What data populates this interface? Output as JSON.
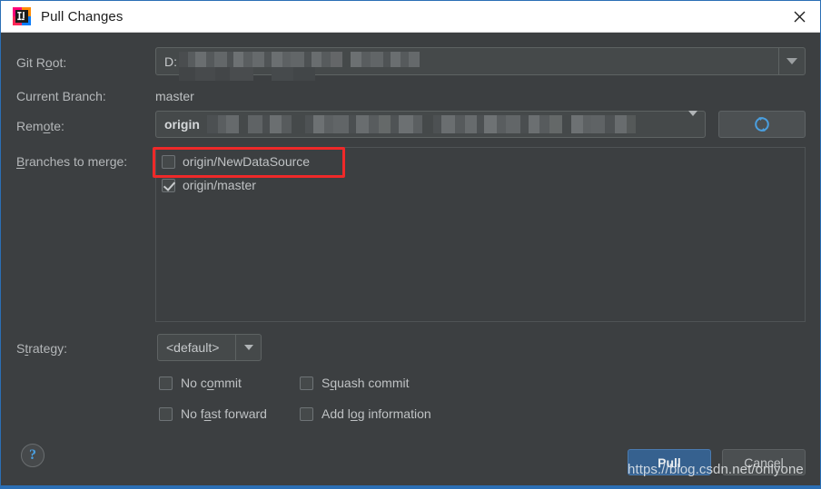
{
  "window": {
    "title": "Pull Changes",
    "app_icon": "intellij-idea-icon",
    "close_icon": "close-icon",
    "accent_color": "#2b6fb5",
    "background_color": "#3c3f41"
  },
  "form": {
    "git_root": {
      "label_pre": "Git R",
      "label_mnemonic": "o",
      "label_post": "ot:",
      "value": "D:",
      "redacted": true,
      "dropdown_icon": "chevron-down-icon"
    },
    "current_branch": {
      "label": "Current Branch:",
      "value": "master"
    },
    "remote": {
      "label_pre": "Rem",
      "label_mnemonic": "o",
      "label_post": "te:",
      "value": "origin",
      "redacted": true,
      "dropdown_icon": "chevron-down-icon",
      "refresh_icon": "refresh-icon",
      "refresh_color": "#4a9fe0"
    },
    "branches_to_merge": {
      "label_pre": "",
      "label_mnemonic": "B",
      "label_post": "ranches to merge:",
      "items": [
        {
          "name": "origin/NewDataSource",
          "checked": false,
          "highlighted": true
        },
        {
          "name": "origin/master",
          "checked": true,
          "highlighted": false
        }
      ],
      "highlight_color": "#ef2929"
    },
    "strategy": {
      "label_pre": "S",
      "label_mnemonic": "t",
      "label_post": "rategy:",
      "value": "<default>",
      "dropdown_icon": "chevron-down-icon"
    },
    "options": [
      {
        "pre": "No c",
        "mn": "o",
        "post": "mmit",
        "checked": false
      },
      {
        "pre": "S",
        "mn": "q",
        "post": "uash commit",
        "checked": false
      },
      {
        "pre": "No f",
        "mn": "a",
        "post": "st forward",
        "checked": false
      },
      {
        "pre": "Add l",
        "mn": "o",
        "post": "g information",
        "checked": false
      }
    ]
  },
  "footer": {
    "help_label": "?",
    "pull_label": "Pull",
    "cancel_label": "Cancel",
    "watermark": "https://blog.csdn.net/onlyone",
    "pull_color": "#36618f"
  }
}
